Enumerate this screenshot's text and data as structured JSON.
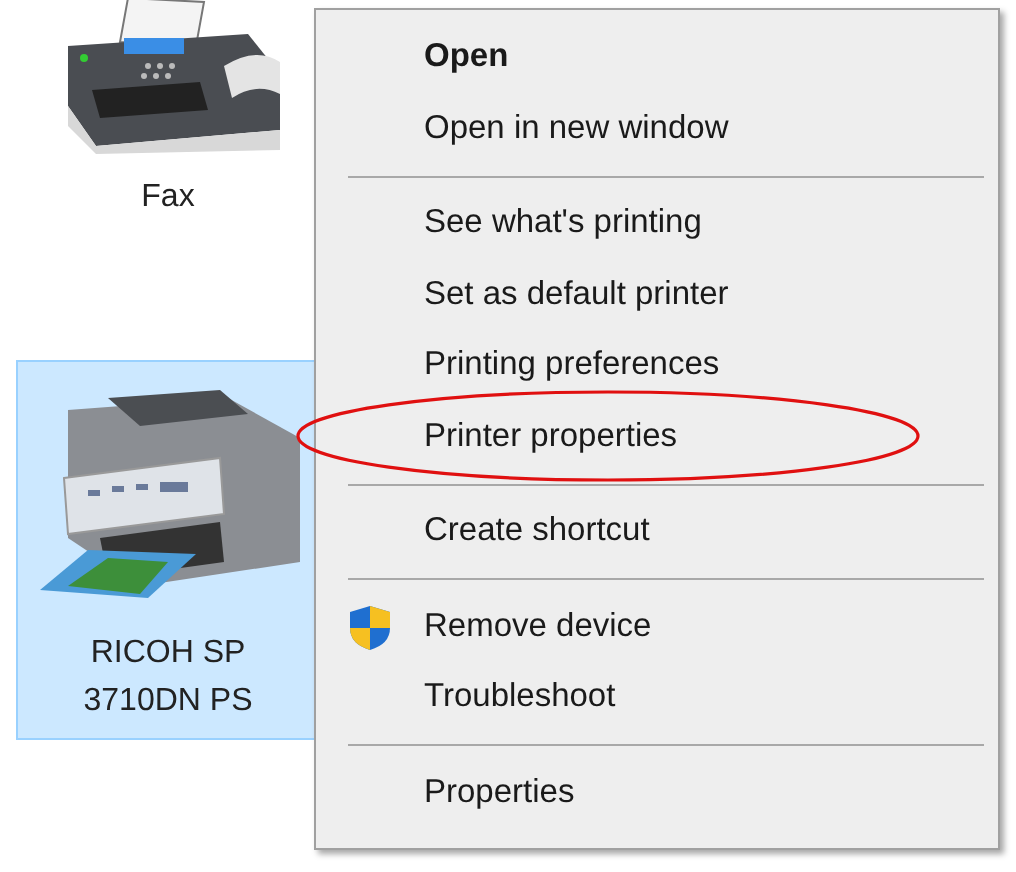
{
  "desktop_items": [
    {
      "label": "Fax",
      "kind": "fax",
      "selected": false
    },
    {
      "label": "RICOH SP 3710DN PS",
      "kind": "printer",
      "selected": true
    }
  ],
  "context_menu": [
    {
      "kind": "item",
      "label": "Open",
      "default": true,
      "circled": false
    },
    {
      "kind": "item",
      "label": "Open in new window",
      "default": false,
      "circled": false
    },
    {
      "kind": "separator"
    },
    {
      "kind": "item",
      "label": "See what's printing",
      "default": false,
      "circled": false
    },
    {
      "kind": "item",
      "label": "Set as default printer",
      "default": false,
      "circled": false
    },
    {
      "kind": "item",
      "label": "Printing preferences",
      "default": false,
      "circled": false
    },
    {
      "kind": "item",
      "label": "Printer properties",
      "default": false,
      "circled": true
    },
    {
      "kind": "separator"
    },
    {
      "kind": "item",
      "label": "Create shortcut",
      "default": false,
      "circled": false
    },
    {
      "kind": "separator"
    },
    {
      "kind": "shield_item",
      "label": "Remove device",
      "default": false,
      "circled": false
    },
    {
      "kind": "item",
      "label": "Troubleshoot",
      "default": false,
      "circled": false
    },
    {
      "kind": "separator"
    },
    {
      "kind": "item",
      "label": "Properties",
      "default": false,
      "circled": false
    }
  ]
}
